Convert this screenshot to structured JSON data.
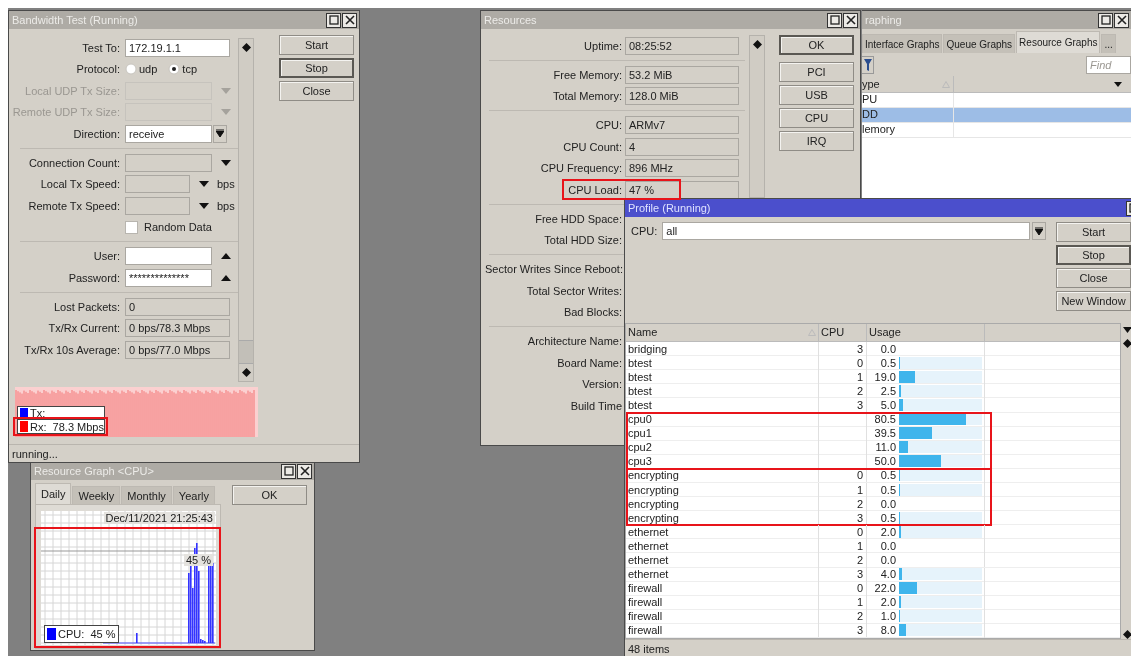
{
  "resource_graph": {
    "title": "Resource Graph <CPU>",
    "active": false,
    "tabs": [
      {
        "label": "Daily",
        "selected": true
      },
      {
        "label": "Weekly",
        "selected": false
      },
      {
        "label": "Monthly",
        "selected": false
      },
      {
        "label": "Yearly",
        "selected": false
      }
    ],
    "ok_button": "OK",
    "timestamp": "Dec/11/2021 21:25:43",
    "current_label": "45 %",
    "legend": {
      "label": "CPU:  45 %",
      "color": "#0000ff"
    },
    "highlighted": true
  },
  "bandwidth_test": {
    "title": "Bandwidth Test (Running)",
    "active": false,
    "fields": [
      {
        "kind": "text",
        "label": "Test To:",
        "value": "172.19.1.1"
      },
      {
        "kind": "radio",
        "label": "Protocol:",
        "options": [
          {
            "label": "udp",
            "selected": false
          },
          {
            "label": "tcp",
            "selected": true
          }
        ]
      },
      {
        "kind": "combo",
        "label": "Local UDP Tx Size:",
        "disabled": true
      },
      {
        "kind": "combo",
        "label": "Remote UDP Tx Size:",
        "disabled": true
      },
      {
        "kind": "select",
        "label": "Direction:",
        "value": "receive"
      },
      {
        "kind": "divider"
      },
      {
        "kind": "combo",
        "label": "Connection Count:",
        "disabled": false
      },
      {
        "kind": "speed",
        "label": "Local Tx Speed:",
        "unit": "bps"
      },
      {
        "kind": "speed",
        "label": "Remote Tx Speed:",
        "unit": "bps"
      },
      {
        "kind": "checkbox",
        "label": "Random Data",
        "checked": false
      },
      {
        "kind": "divider"
      },
      {
        "kind": "up",
        "label": "User:"
      },
      {
        "kind": "up",
        "label": "Password:",
        "value": "**************"
      },
      {
        "kind": "divider"
      },
      {
        "kind": "readonly",
        "label": "Lost Packets:",
        "value": "0"
      },
      {
        "kind": "readonly",
        "label": "Tx/Rx Current:",
        "value": "0 bps/78.3 Mbps"
      },
      {
        "kind": "readonly",
        "label": "Tx/Rx 10s Average:",
        "value": "0 bps/77.0 Mbps"
      }
    ],
    "buttons": [
      {
        "label": "Start",
        "focused": false
      },
      {
        "label": "Stop",
        "focused": true
      },
      {
        "label": "Close",
        "focused": false
      }
    ],
    "legend": [
      {
        "label": "Tx:",
        "color": "#0000ff",
        "highlighted": false
      },
      {
        "label": "Rx:  78.3 Mbps",
        "color": "#ff0000",
        "highlighted": true
      }
    ],
    "status": "running..."
  },
  "resources": {
    "title": "Resources",
    "active": false,
    "rows": [
      {
        "kind": "field",
        "label": "Uptime:",
        "value": "08:25:52",
        "highlighted": false
      },
      {
        "kind": "divider"
      },
      {
        "kind": "field",
        "label": "Free Memory:",
        "value": "53.2 MiB",
        "highlighted": false
      },
      {
        "kind": "field",
        "label": "Total Memory:",
        "value": "128.0 MiB",
        "highlighted": false
      },
      {
        "kind": "divider"
      },
      {
        "kind": "field",
        "label": "CPU:",
        "value": "ARMv7",
        "highlighted": false
      },
      {
        "kind": "field",
        "label": "CPU Count:",
        "value": "4",
        "highlighted": false
      },
      {
        "kind": "field",
        "label": "CPU Frequency:",
        "value": "896 MHz",
        "highlighted": false
      },
      {
        "kind": "field",
        "label": "CPU Load:",
        "value": "47 %",
        "highlighted": true
      },
      {
        "kind": "divider"
      },
      {
        "kind": "label",
        "label": "Free HDD Space:"
      },
      {
        "kind": "label",
        "label": "Total HDD Size:"
      },
      {
        "kind": "divider"
      },
      {
        "kind": "label",
        "label": "Sector Writes Since Reboot:"
      },
      {
        "kind": "label",
        "label": "Total Sector Writes:"
      },
      {
        "kind": "label",
        "label": "Bad Blocks:"
      },
      {
        "kind": "divider"
      },
      {
        "kind": "label",
        "label": "Architecture Name:"
      },
      {
        "kind": "label",
        "label": "Board Name:"
      },
      {
        "kind": "label",
        "label": "Version:"
      },
      {
        "kind": "label",
        "label": "Build Time"
      }
    ],
    "buttons": [
      {
        "label": "OK",
        "focused": true
      },
      {
        "label": "PCI",
        "focused": false
      },
      {
        "label": "USB",
        "focused": false
      },
      {
        "label": "CPU",
        "focused": false
      },
      {
        "label": "IRQ",
        "focused": false
      }
    ]
  },
  "graphing": {
    "title": "raphing",
    "active": false,
    "tabs": [
      {
        "label": "Interface Graphs",
        "selected": false
      },
      {
        "label": "Queue Graphs",
        "selected": false
      },
      {
        "label": "Resource Graphs",
        "selected": true
      },
      {
        "label": "...",
        "selected": false
      }
    ],
    "search": {
      "placeholder": "Find"
    },
    "columns": [
      "ype"
    ],
    "rows": [
      {
        "type": "PU",
        "selected": false
      },
      {
        "type": "DD",
        "selected": true
      },
      {
        "type": "lemory",
        "selected": false
      }
    ]
  },
  "profile": {
    "title": "Profile (Running)",
    "active": true,
    "cpu_label": "CPU:",
    "cpu_value": "all",
    "buttons": [
      {
        "label": "Start",
        "focused": false
      },
      {
        "label": "Stop",
        "focused": true
      },
      {
        "label": "Close",
        "focused": false
      },
      {
        "label": "New Window",
        "focused": false
      }
    ],
    "columns": [
      "Name",
      "CPU",
      "Usage"
    ],
    "row_groups": [
      {
        "highlighted": false,
        "rows": [
          {
            "name": "bridging",
            "cpu": "3",
            "usage": "0.0"
          },
          {
            "name": "btest",
            "cpu": "0",
            "usage": "0.5",
            "level": 0.005
          },
          {
            "name": "btest",
            "cpu": "1",
            "usage": "19.0",
            "level": 0.19
          },
          {
            "name": "btest",
            "cpu": "2",
            "usage": "2.5",
            "level": 0.025
          },
          {
            "name": "btest",
            "cpu": "3",
            "usage": "5.0",
            "level": 0.05
          }
        ]
      },
      {
        "highlighted": true,
        "rows": [
          {
            "name": "cpu0",
            "usage": "80.5",
            "level": 0.805
          },
          {
            "name": "cpu1",
            "usage": "39.5",
            "level": 0.395
          },
          {
            "name": "cpu2",
            "usage": "11.0",
            "level": 0.11
          },
          {
            "name": "cpu3",
            "usage": "50.0",
            "level": 0.5
          }
        ]
      },
      {
        "highlighted": true,
        "rows": [
          {
            "name": "encrypting",
            "cpu": "0",
            "usage": "0.5",
            "level": 0.005
          },
          {
            "name": "encrypting",
            "cpu": "1",
            "usage": "0.5",
            "level": 0.005
          },
          {
            "name": "encrypting",
            "cpu": "2",
            "usage": "0.0"
          },
          {
            "name": "encrypting",
            "cpu": "3",
            "usage": "0.5",
            "level": 0.005
          }
        ]
      },
      {
        "highlighted": false,
        "rows": [
          {
            "name": "ethernet",
            "cpu": "0",
            "usage": "2.0",
            "level": 0.02
          },
          {
            "name": "ethernet",
            "cpu": "1",
            "usage": "0.0"
          },
          {
            "name": "ethernet",
            "cpu": "2",
            "usage": "0.0"
          },
          {
            "name": "ethernet",
            "cpu": "3",
            "usage": "4.0",
            "level": 0.04
          },
          {
            "name": "firewall",
            "cpu": "0",
            "usage": "22.0",
            "level": 0.22
          },
          {
            "name": "firewall",
            "cpu": "1",
            "usage": "2.0",
            "level": 0.02
          },
          {
            "name": "firewall",
            "cpu": "2",
            "usage": "1.0",
            "level": 0.01
          },
          {
            "name": "firewall",
            "cpu": "3",
            "usage": "8.0",
            "level": 0.08
          }
        ]
      }
    ],
    "status": "48 items"
  }
}
